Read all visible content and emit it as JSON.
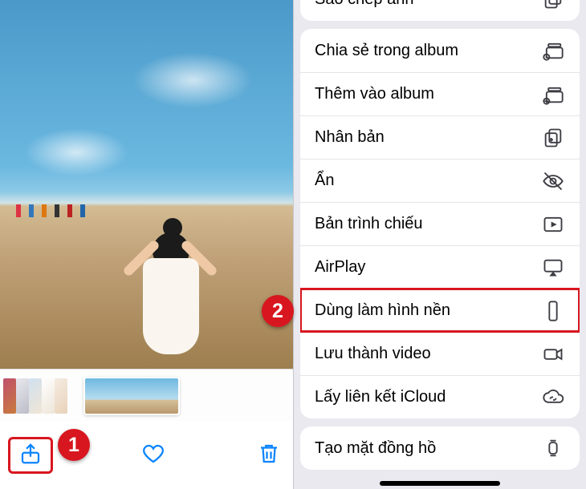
{
  "toolbar": {
    "share_label": "Share",
    "favorite_label": "Favorite",
    "trash_label": "Delete"
  },
  "badges": {
    "one": "1",
    "two": "2"
  },
  "menu": {
    "copy_photo": "Sao chép ảnh",
    "share_album": "Chia sẻ trong album",
    "add_to_album": "Thêm vào album",
    "duplicate": "Nhân bản",
    "hide": "Ẩn",
    "slideshow": "Bản trình chiếu",
    "airplay": "AirPlay",
    "use_as_wallpaper": "Dùng làm hình nền",
    "save_as_video": "Lưu thành video",
    "icloud_link": "Lấy liên kết iCloud",
    "create_watch_face": "Tạo mặt đồng hồ"
  }
}
